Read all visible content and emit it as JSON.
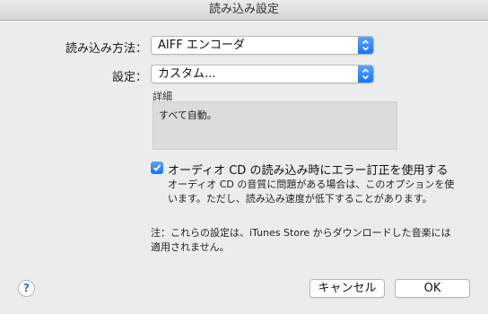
{
  "window": {
    "title": "読み込み設定"
  },
  "import_using": {
    "label": "読み込み方法：",
    "value": "AIFF エンコーダ"
  },
  "setting": {
    "label": "設定：",
    "value": "カスタム..."
  },
  "details": {
    "label": "詳細",
    "text": "すべて自動。"
  },
  "error_correction": {
    "checked": true,
    "label": "オーディオ CD の読み込み時にエラー訂正を使用する",
    "description": "オーディオ CD の音質に問題がある場合は、このオプションを使います。ただし、読み込み速度が低下することがあります。"
  },
  "note": "注：これらの設定は、iTunes Store からダウンロードした音楽には適用されません。",
  "buttons": {
    "help": "?",
    "cancel": "キャンセル",
    "ok": "OK"
  },
  "colors": {
    "accent": "#1874f2",
    "background": "#ececec"
  }
}
